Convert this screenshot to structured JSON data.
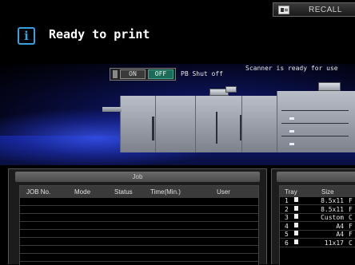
{
  "topbar": {
    "recall_label": "RECALL"
  },
  "status": {
    "message": "Ready to print",
    "icon": "info-icon",
    "icon_glyph": "i"
  },
  "pb_shutoff": {
    "on_label": "ON",
    "off_label": "OFF",
    "label": "PB Shut off",
    "selected": "OFF"
  },
  "scanner_status": "Scanner is ready for use",
  "job_panel": {
    "title": "Job",
    "columns": [
      "JOB No.",
      "Mode",
      "Status",
      "Time(Min.)",
      "User"
    ],
    "rows": []
  },
  "tray_panel": {
    "columns": [
      "Tray",
      "Size"
    ],
    "rows": [
      {
        "tray": "1",
        "size": "8.5x11",
        "extra": "F"
      },
      {
        "tray": "2",
        "size": "8.5x11",
        "extra": "F"
      },
      {
        "tray": "3",
        "size": "Custom",
        "extra": "C"
      },
      {
        "tray": "4",
        "size": "A4",
        "extra": "F"
      },
      {
        "tray": "5",
        "size": "A4",
        "extra": "F"
      },
      {
        "tray": "6",
        "size": "11x17",
        "extra": "C"
      }
    ]
  },
  "colors": {
    "accent": "#3aa0e0",
    "off_active": "#1b6a5a",
    "background": "#000000"
  }
}
